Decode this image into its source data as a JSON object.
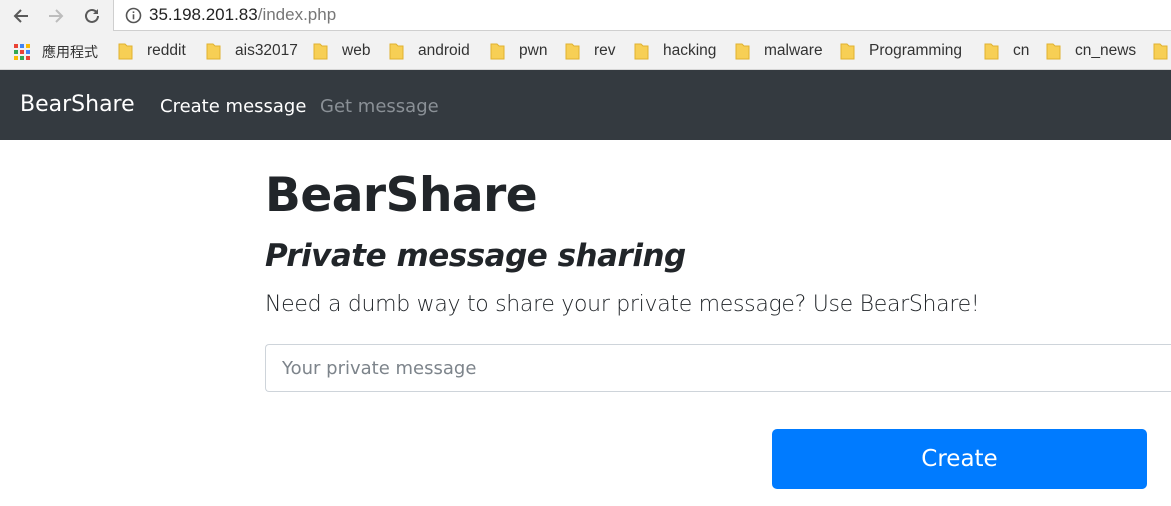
{
  "browser": {
    "url_host": "35.198.201.83",
    "url_path": "/index.php",
    "icons": {
      "back": "back-arrow-icon",
      "forward": "forward-arrow-icon",
      "reload": "reload-icon",
      "info": "info-icon"
    }
  },
  "bookmarks": {
    "apps_label": "應用程式",
    "items": [
      {
        "label": "reddit"
      },
      {
        "label": "ais32017"
      },
      {
        "label": "web"
      },
      {
        "label": "android"
      },
      {
        "label": "pwn"
      },
      {
        "label": "rev"
      },
      {
        "label": "hacking"
      },
      {
        "label": "malware"
      },
      {
        "label": "Programming"
      },
      {
        "label": "cn"
      },
      {
        "label": "cn_news"
      }
    ],
    "folder_color": "#f7cf55"
  },
  "navbar": {
    "brand": "BearShare",
    "links": [
      {
        "label": "Create message",
        "active": true
      },
      {
        "label": "Get message",
        "active": false
      }
    ],
    "bg_color": "#343a40"
  },
  "main": {
    "title": "BearShare",
    "subtitle": "Private message sharing",
    "lead": "Need a dumb way to share your private message? Use BearShare!",
    "input_placeholder": "Your private message",
    "input_value": "",
    "button_label": "Create",
    "accent_color": "#007bff"
  }
}
